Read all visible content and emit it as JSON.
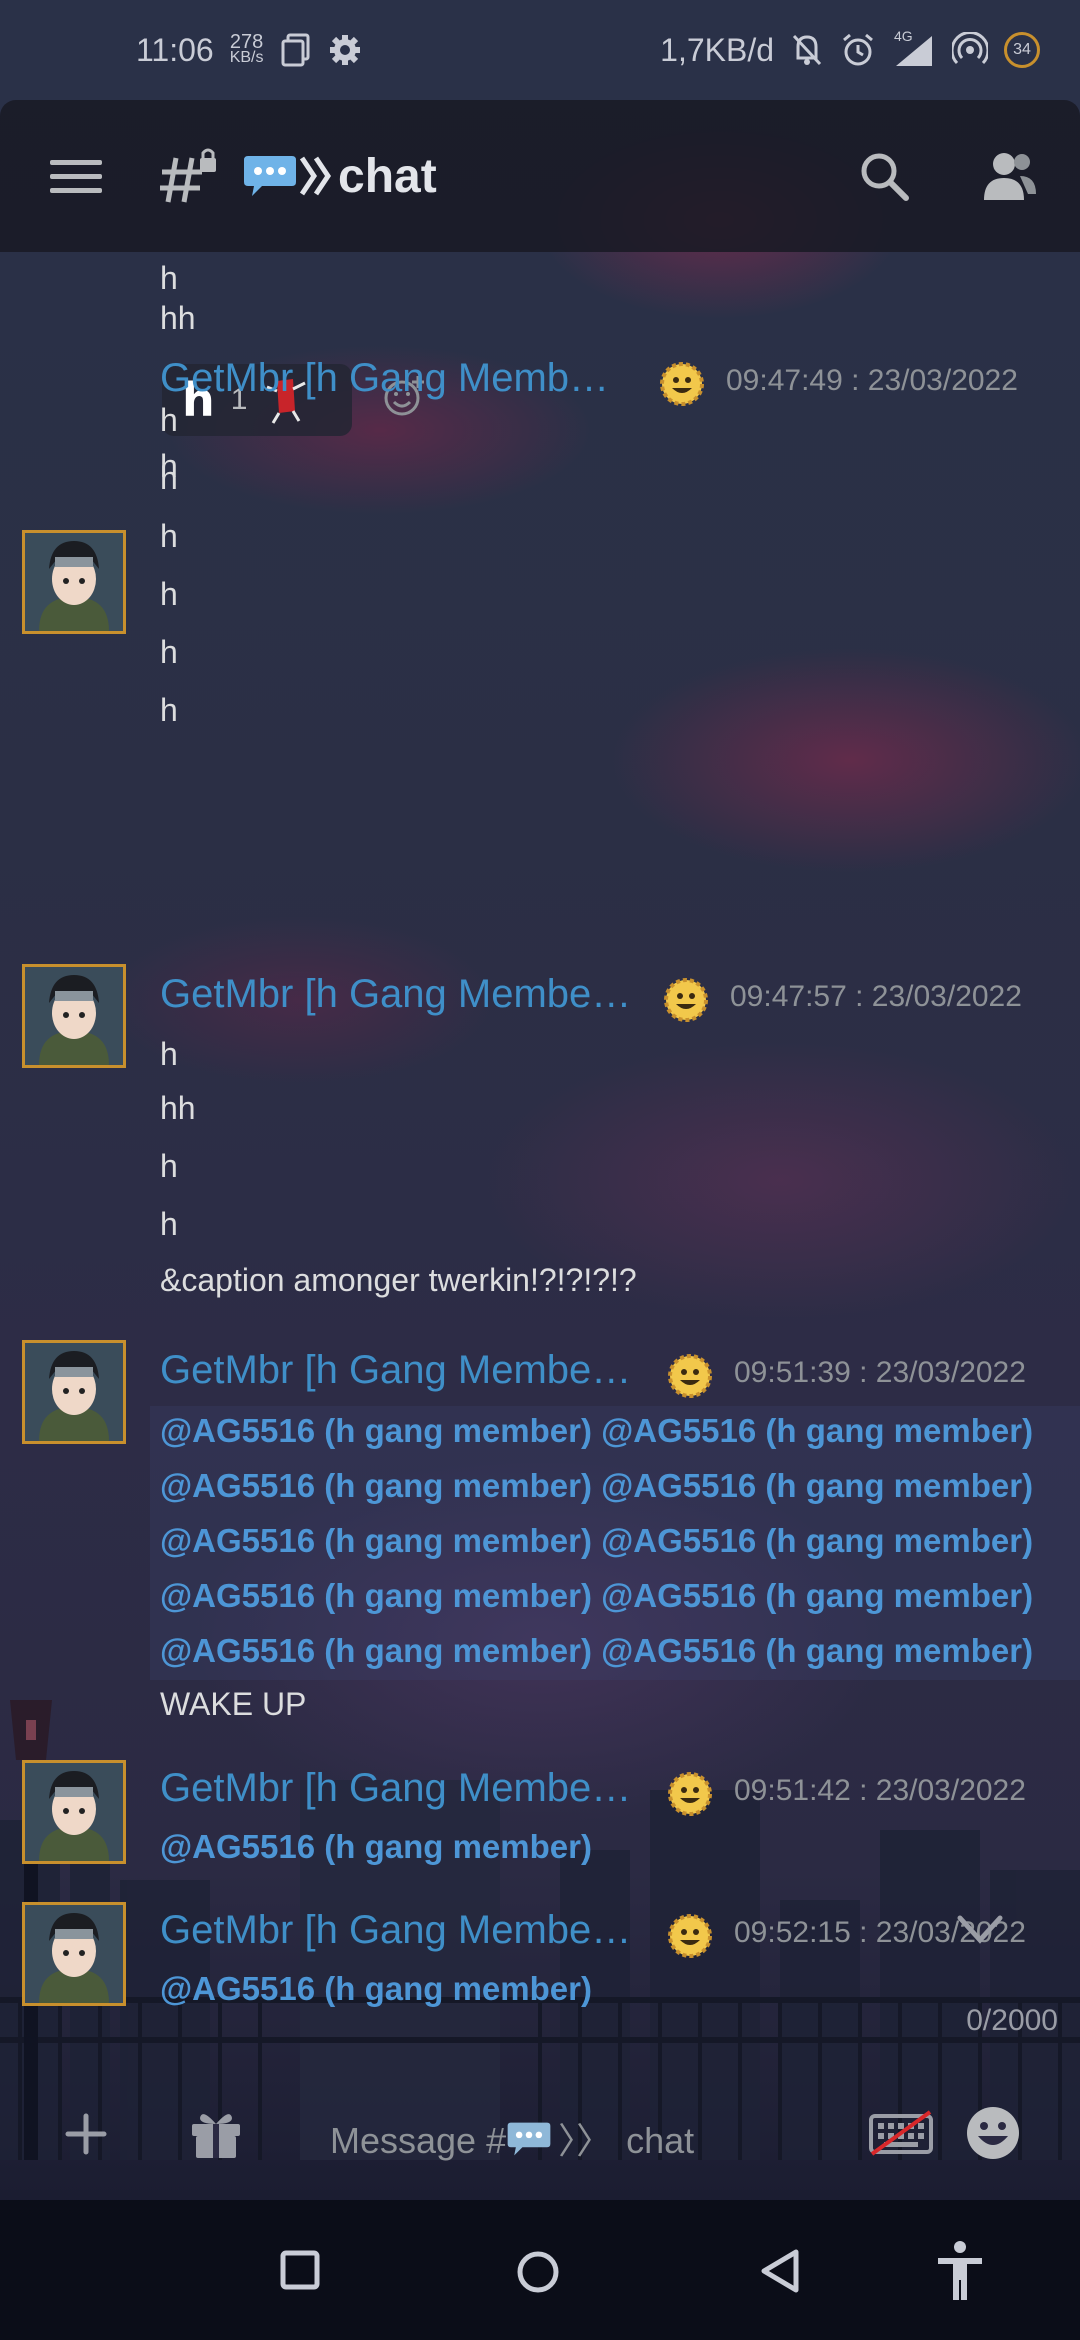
{
  "status_bar": {
    "time": "11:06",
    "speed_value": "278",
    "speed_unit": "KB/s",
    "data_usage": "1,7KB/d",
    "network": "4G",
    "battery": "34"
  },
  "header": {
    "channel_name": "chat"
  },
  "messages": {
    "top_lines": [
      "h",
      "hh"
    ],
    "reaction": {
      "emoji_letter": "h",
      "count": "1"
    },
    "after_reaction_line": "h",
    "groups": [
      {
        "author": "GetMbr [h Gang Memb…",
        "timestamp": "09:47:49 : 23/03/2022",
        "lines": [
          "h",
          "h",
          "h",
          "h",
          "h",
          "h"
        ]
      },
      {
        "author": "GetMbr [h Gang Membe…",
        "timestamp": "09:47:57 : 23/03/2022",
        "lines": [
          "h",
          "hh",
          "h",
          "h",
          "&caption amonger twerkin!?!?!?!?"
        ]
      },
      {
        "author": "GetMbr [h Gang Membe…",
        "timestamp": "09:51:39 : 23/03/2022",
        "mention_rows": [
          "@AG5516 (h gang member) @AG5516 (h gang member)",
          "@AG5516 (h gang member) @AG5516 (h gang member)",
          "@AG5516 (h gang member) @AG5516 (h gang member)",
          "@AG5516 (h gang member) @AG5516 (h gang member)",
          "@AG5516 (h gang member) @AG5516 (h gang member)"
        ],
        "trailing_line": "WAKE UP"
      },
      {
        "author": "GetMbr [h Gang Membe…",
        "timestamp": "09:51:42 : 23/03/2022",
        "mention": "@AG5516 (h gang member)"
      },
      {
        "author": "GetMbr [h Gang Membe…",
        "timestamp": "09:52:15 : 23/03/2022",
        "mention": "@AG5516 (h gang member)"
      }
    ]
  },
  "composer": {
    "char_count": "0/2000",
    "placeholder_prefix": "Message #",
    "placeholder_channel": "chat"
  },
  "colors": {
    "author": "#3f8fc8",
    "mention": "#4d96d6",
    "avatar_border": "#c8902d",
    "timestamp": "#8e9297"
  }
}
